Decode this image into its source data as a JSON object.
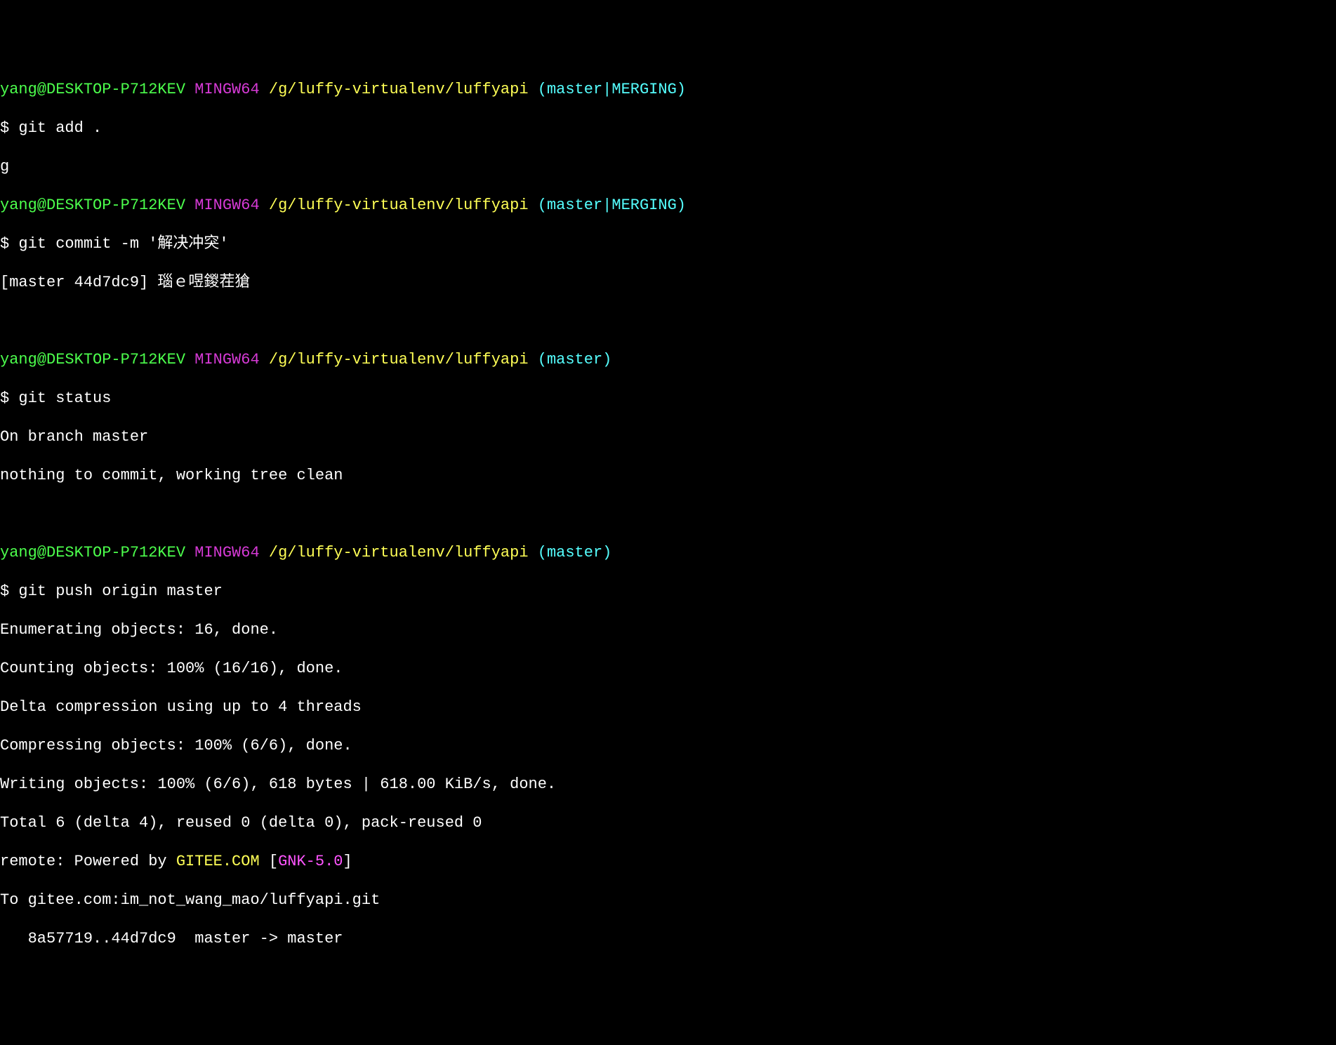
{
  "prompts": [
    {
      "user": "yang@DESKTOP-P712KEV",
      "mingw": "MINGW64",
      "path": "/g/luffy-virtualenv/luffyapi",
      "branch": "(master|MERGING)"
    },
    {
      "user": "yang@DESKTOP-P712KEV",
      "mingw": "MINGW64",
      "path": "/g/luffy-virtualenv/luffyapi",
      "branch": "(master|MERGING)"
    },
    {
      "user": "yang@DESKTOP-P712KEV",
      "mingw": "MINGW64",
      "path": "/g/luffy-virtualenv/luffyapi",
      "branch": "(master)"
    },
    {
      "user": "yang@DESKTOP-P712KEV",
      "mingw": "MINGW64",
      "path": "/g/luffy-virtualenv/luffyapi",
      "branch": "(master)"
    }
  ],
  "commands": {
    "c1": "$ git add .",
    "c1b": "g",
    "c2": "$ git commit -m '解决冲突'",
    "c3": "$ git status",
    "c4": "$ git push origin master"
  },
  "output": {
    "commit_result": "[master 44d7dc9] 瑙ｅ喅鍐茬獊",
    "status_line1": "On branch master",
    "status_line2": "nothing to commit, working tree clean",
    "push_line1": "Enumerating objects: 16, done.",
    "push_line2": "Counting objects: 100% (16/16), done.",
    "push_line3": "Delta compression using up to 4 threads",
    "push_line4": "Compressing objects: 100% (6/6), done.",
    "push_line5": "Writing objects: 100% (6/6), 618 bytes | 618.00 KiB/s, done.",
    "push_line6": "Total 6 (delta 4), reused 0 (delta 0), pack-reused 0",
    "push_remote_prefix": "remote: Powered by ",
    "push_remote_gitee": "GITEE.COM",
    "push_remote_bracket_open": " [",
    "push_remote_gnk": "GNK-5.0",
    "push_remote_bracket_close": "]",
    "push_line8": "To gitee.com:im_not_wang_mao/luffyapi.git",
    "push_line9": "   8a57719..44d7dc9  master -> master"
  }
}
